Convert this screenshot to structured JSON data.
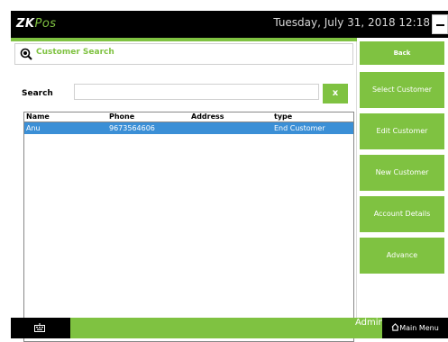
{
  "app": {
    "logo_main": "ZK",
    "logo_sub": "Pos",
    "datetime": "Tuesday, July 31, 2018 12:18"
  },
  "search_header": {
    "title": "Customer Search"
  },
  "search": {
    "label": "Search",
    "value": "",
    "clear_label": "x"
  },
  "table": {
    "columns": [
      "Name",
      "Phone",
      "Address",
      "type"
    ],
    "rows": [
      {
        "name": "Anu",
        "phone": "9673564606",
        "address": "",
        "type": "End Customer",
        "selected": true
      }
    ]
  },
  "sidebar": {
    "back": "Back",
    "select_customer": "Select Customer",
    "edit_customer": "Edit Customer",
    "new_customer": "New Customer",
    "account_details": "Account Details",
    "advance": "Advance"
  },
  "bottom": {
    "user": "Admin",
    "main_menu": "Main Menu"
  },
  "colors": {
    "accent": "#7fc241",
    "selection": "#3b8fd6",
    "bar": "#000000"
  },
  "icons": [
    "search-icon",
    "keyboard-icon",
    "home-icon",
    "minimize-icon"
  ]
}
